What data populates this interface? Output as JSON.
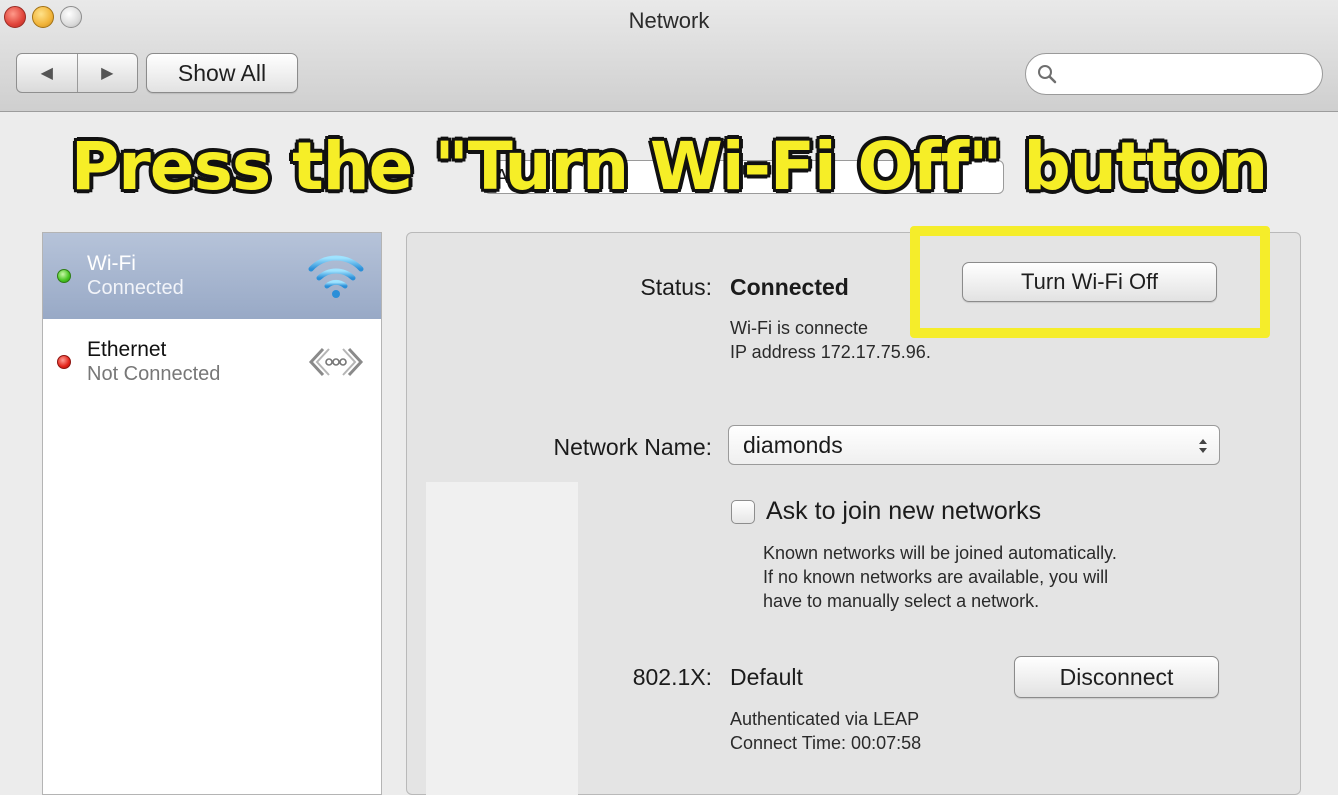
{
  "window": {
    "title": "Network"
  },
  "toolbar": {
    "back_glyph": "◀",
    "forward_glyph": "▶",
    "show_all_label": "Show All",
    "search_placeholder": ""
  },
  "instruction": "Press the \"Turn Wi-Fi Off\" button",
  "location": {
    "value": "A"
  },
  "services": [
    {
      "name": "Wi-Fi",
      "status": "Connected",
      "status_color": "#45c41f",
      "icon": "wifi-icon",
      "selected": true
    },
    {
      "name": "Ethernet",
      "status": "Not Connected",
      "status_color": "#e3241a",
      "icon": "ethernet-icon",
      "selected": false
    }
  ],
  "detail": {
    "status_label": "Status:",
    "status_value": "Connected",
    "status_desc_line1": "Wi-Fi is connecte",
    "status_desc_line2": "IP address 172.17.75.96.",
    "turn_off_label": "Turn Wi-Fi Off",
    "network_name_label": "Network Name:",
    "network_name_value": "diamonds",
    "ask_join_label": "Ask to join new networks",
    "ask_join_checked": false,
    "known_desc_line1": "Known networks will be joined automatically.",
    "known_desc_line2": "If no known networks are available, you will",
    "known_desc_line3": "have to manually select a network.",
    "dot1x_label": "802.1X:",
    "dot1x_value": "Default",
    "disconnect_label": "Disconnect",
    "auth_line1": "Authenticated via LEAP",
    "auth_line2": "Connect Time: 00:07:58"
  },
  "colors": {
    "highlight": "#f5ed2a",
    "selected_row": "#a4b4cf",
    "instruction_text": "#f6ee27"
  }
}
